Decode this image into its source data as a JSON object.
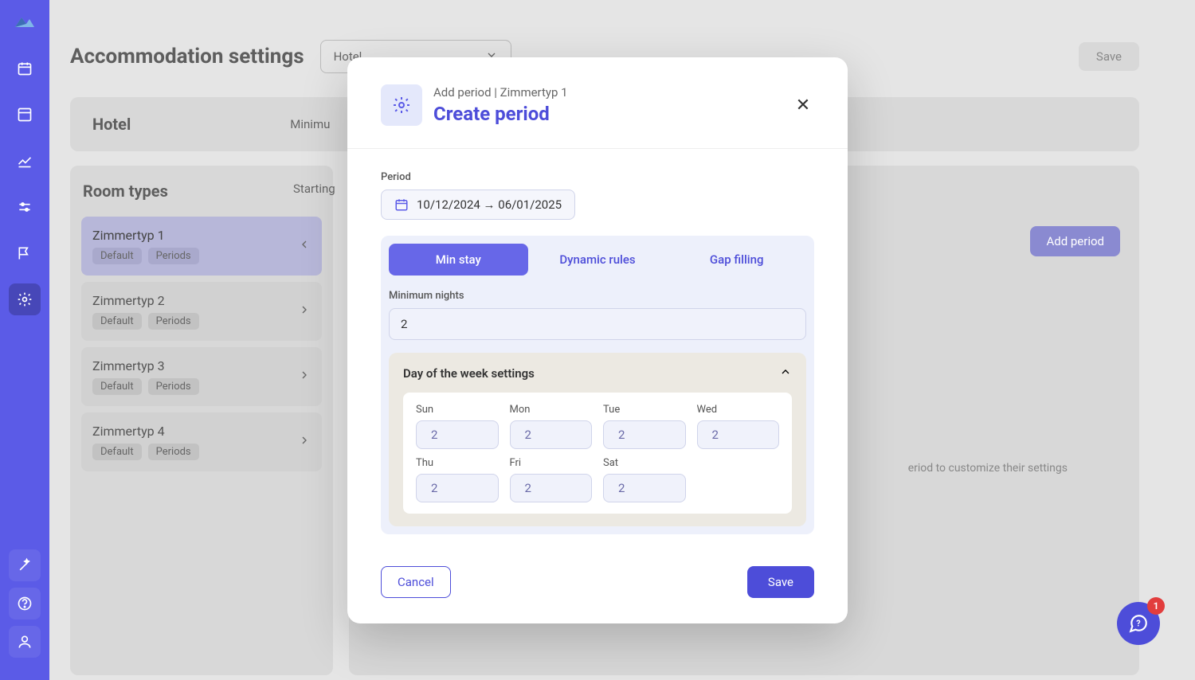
{
  "page": {
    "title": "Accommodation settings",
    "hotel_select_label": "Hotel",
    "save_label": "Save"
  },
  "hotel_row": {
    "title": "Hotel",
    "subtitle": "Minimu"
  },
  "room_types": {
    "title": "Room types",
    "starting_label": "Starting",
    "add_period_label": "Add period",
    "info_text": "eriod to customize their settings",
    "items": [
      {
        "name": "Zimmertyp 1",
        "tag_default": "Default",
        "tag_periods": "Periods",
        "selected": true,
        "chev": "left"
      },
      {
        "name": "Zimmertyp 2",
        "tag_default": "Default",
        "tag_periods": "Periods",
        "selected": false,
        "chev": "right"
      },
      {
        "name": "Zimmertyp 3",
        "tag_default": "Default",
        "tag_periods": "Periods",
        "selected": false,
        "chev": "right"
      },
      {
        "name": "Zimmertyp 4",
        "tag_default": "Default",
        "tag_periods": "Periods",
        "selected": false,
        "chev": "right"
      }
    ]
  },
  "modal": {
    "breadcrumb": "Add period | Zimmertyp 1",
    "title": "Create period",
    "period_label": "Period",
    "date_range": "10/12/2024 → 06/01/2025",
    "tabs": {
      "min_stay": "Min stay",
      "dynamic_rules": "Dynamic rules",
      "gap_filling": "Gap filling"
    },
    "min_nights_label": "Minimum nights",
    "min_nights_value": "2",
    "dow_title": "Day of the week settings",
    "days": [
      {
        "label": "Sun",
        "value": "2"
      },
      {
        "label": "Mon",
        "value": "2"
      },
      {
        "label": "Tue",
        "value": "2"
      },
      {
        "label": "Wed",
        "value": "2"
      },
      {
        "label": "Thu",
        "value": "2"
      },
      {
        "label": "Fri",
        "value": "2"
      },
      {
        "label": "Sat",
        "value": "2"
      }
    ],
    "cancel_label": "Cancel",
    "save_label": "Save"
  },
  "help": {
    "count": "1"
  }
}
